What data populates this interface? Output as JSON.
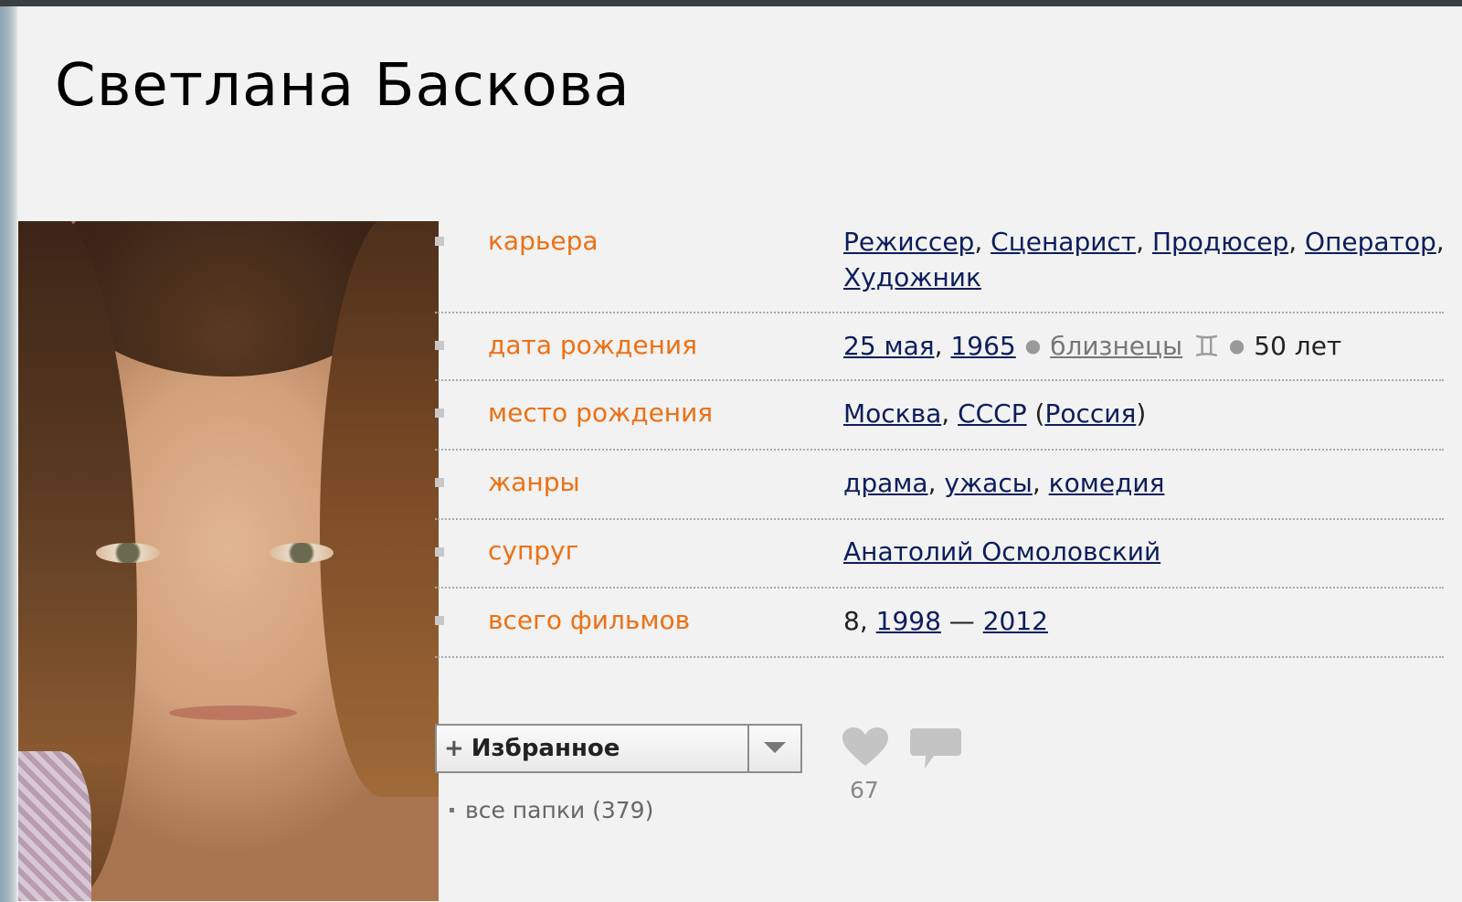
{
  "person": {
    "name": "Светлана Баскова"
  },
  "info_rows": {
    "career": {
      "label": "карьера",
      "links": [
        "Режиссер",
        "Сценарист",
        "Продюсер",
        "Оператор",
        "Художник"
      ]
    },
    "birth_date": {
      "label": "дата рождения",
      "day_month": "25 мая",
      "year": "1965",
      "zodiac": "близнецы",
      "zodiac_icon": "gemini-icon",
      "age": "50 лет"
    },
    "birth_place": {
      "label": "место рождения",
      "city": "Москва",
      "country": "СССР",
      "current_country": "Россия"
    },
    "genres": {
      "label": "жанры",
      "items": [
        "драма",
        "ужасы",
        "комедия"
      ]
    },
    "spouse": {
      "label": "супруг",
      "name": "Анатолий Осмоловский"
    },
    "total_films": {
      "label": "всего фильмов",
      "count": "8",
      "year_from": "1998",
      "year_to": "2012"
    }
  },
  "favorites": {
    "plus_icon": "plus-icon",
    "label": "Избранное",
    "dropdown_icon": "chevron-down-icon",
    "folders_link": "все папки (379)"
  },
  "social": {
    "like_icon": "heart-icon",
    "like_count": "67",
    "comment_icon": "comment-icon"
  },
  "colors": {
    "label_orange": "#f06f12",
    "link_navy": "#0c1d5e",
    "background": "#f2f2f2"
  }
}
